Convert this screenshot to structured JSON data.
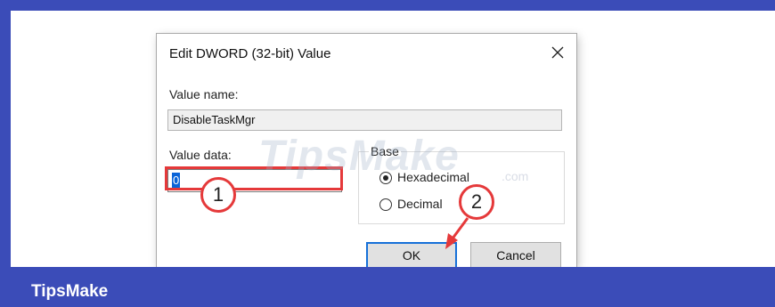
{
  "dialog": {
    "title": "Edit DWORD (32-bit) Value",
    "value_name_label": "Value name:",
    "value_name": "DisableTaskMgr",
    "value_data_label": "Value data:",
    "value_data": "0",
    "base_label": "Base",
    "base_options": [
      {
        "label": "Hexadecimal",
        "checked": true
      },
      {
        "label": "Decimal",
        "checked": false
      }
    ],
    "ok_label": "OK",
    "cancel_label": "Cancel"
  },
  "annotations": {
    "step1": "1",
    "step2": "2"
  },
  "watermark": {
    "text": "TipsMake",
    "suffix": ".com"
  },
  "footer": {
    "brand": "TipsMake"
  },
  "colors": {
    "frame": "#3b4cb8",
    "highlight": "#e5393a",
    "selection": "#0a64d8",
    "ok_border": "#1670d8"
  }
}
